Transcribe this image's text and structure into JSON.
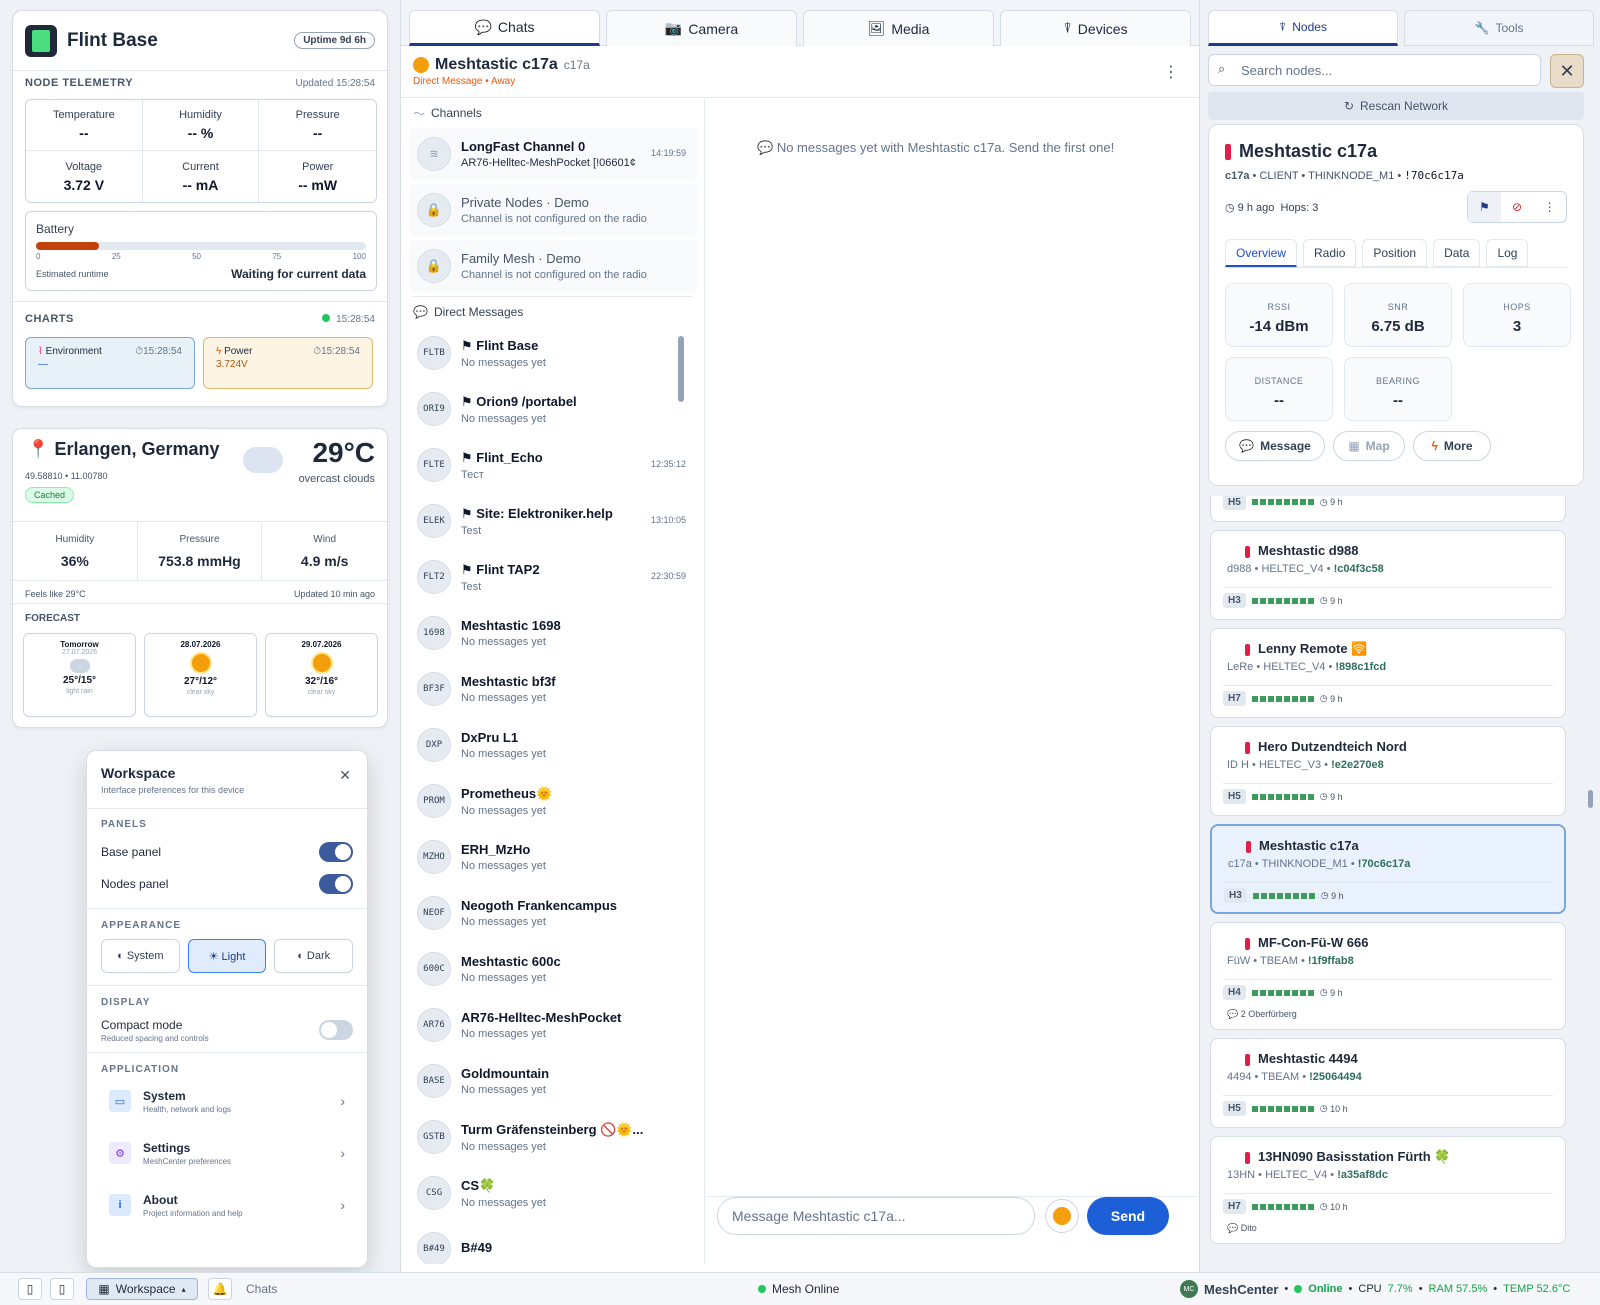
{
  "base": {
    "title": "Flint Base",
    "uptime": "Uptime 9d 6h",
    "telemetry_heading": "NODE TELEMETRY",
    "telemetry_updated": "Updated 15:28:54",
    "telemetry": [
      {
        "label": "Temperature",
        "value": "--"
      },
      {
        "label": "Humidity",
        "value": "-- %"
      },
      {
        "label": "Pressure",
        "value": "--"
      },
      {
        "label": "Voltage",
        "value": "3.72 V"
      },
      {
        "label": "Current",
        "value": "-- mA"
      },
      {
        "label": "Power",
        "value": "-- mW"
      }
    ],
    "battery_label": "Battery",
    "battery_level": 0.19,
    "battery_ticks": [
      "0",
      "25",
      "50",
      "75",
      "100"
    ],
    "runtime_label": "Estimated runtime",
    "runtime_value": "Waiting for current data",
    "charts_heading": "CHARTS",
    "charts_time": "15:28:54",
    "env_tile": {
      "label": "Environment",
      "time": "15:28:54",
      "value": "—"
    },
    "power_tile": {
      "label": "Power",
      "time": "15:28:54",
      "value": "3.724V"
    }
  },
  "weather": {
    "location": "Erlangen, Germany",
    "coords": "49.58810 • 11.00780",
    "temp": "29°C",
    "condition": "overcast clouds",
    "cached": "Cached",
    "stats": [
      {
        "label": "Humidity",
        "value": "36%"
      },
      {
        "label": "Pressure",
        "value": "753.8 mmHg"
      },
      {
        "label": "Wind",
        "value": "4.9 m/s"
      }
    ],
    "feels": "Feels like 29°C",
    "updated": "Updated 10 min ago",
    "forecast_heading": "FORECAST",
    "forecast": [
      {
        "title": "Tomorrow",
        "date": "27.07.2026",
        "temp": "25°/15°",
        "desc": "light rain"
      },
      {
        "title": "28.07.2026",
        "date": "",
        "temp": "27°/12°",
        "desc": "clear sky"
      },
      {
        "title": "29.07.2026",
        "date": "",
        "temp": "32°/16°",
        "desc": "clear sky"
      }
    ]
  },
  "workspace": {
    "title": "Workspace",
    "subtitle": "Interface preferences for this device",
    "panels_heading": "PANELS",
    "base_panel": "Base panel",
    "nodes_panel": "Nodes panel",
    "appearance_heading": "APPEARANCE",
    "themes": [
      "◐ System",
      "☀ Light",
      "◐ Dark"
    ],
    "display_heading": "DISPLAY",
    "compact": "Compact mode",
    "compact_sub": "Reduced spacing and controls",
    "application_heading": "APPLICATION",
    "apps": [
      {
        "title": "System",
        "sub": "Health, network and logs"
      },
      {
        "title": "Settings",
        "sub": "MeshCenter preferences"
      },
      {
        "title": "About",
        "sub": "Project information and help"
      }
    ]
  },
  "mid": {
    "tabs": [
      "Chats",
      "Camera",
      "Media",
      "Devices"
    ],
    "chat_name": "Meshtastic c17a",
    "chat_short": "c17a",
    "chat_status": "Direct Message • Away",
    "channels_heading": "Channels",
    "channels": [
      {
        "title": "LongFast Channel 0",
        "sub": "AR76-Helltec-MeshPocket [!06601¢",
        "time": "14:19:59",
        "icon": "≋"
      },
      {
        "title": "Private Nodes · Demo",
        "sub": "Channel is not configured on the radio",
        "time": "",
        "icon": "🔒"
      },
      {
        "title": "Family Mesh · Demo",
        "sub": "Channel is not configured on the radio",
        "time": "",
        "icon": "🔒"
      }
    ],
    "dm_heading": "Direct Messages",
    "dms": [
      {
        "av": "FLTB",
        "title": "⚑ Flint Base",
        "sub": "No messages yet",
        "time": ""
      },
      {
        "av": "ORI9",
        "title": "⚑ Orion9 /portabel",
        "sub": "No messages yet",
        "time": ""
      },
      {
        "av": "FLTE",
        "title": "⚑ Flint_Echo",
        "sub": "Тест",
        "time": "12:35:12"
      },
      {
        "av": "ELEK",
        "title": "⚑ Site: Elektroniker.help",
        "sub": "Test",
        "time": "13:10:05"
      },
      {
        "av": "FLT2",
        "title": "⚑ Flint TAP2",
        "sub": "Test",
        "time": "22:30:59"
      },
      {
        "av": "1698",
        "title": "Meshtastic 1698",
        "sub": "No messages yet",
        "time": ""
      },
      {
        "av": "BF3F",
        "title": "Meshtastic bf3f",
        "sub": "No messages yet",
        "time": ""
      },
      {
        "av": "DXP",
        "title": "DxPru L1",
        "sub": "No messages yet",
        "time": ""
      },
      {
        "av": "PROM",
        "title": "Prometheus🌞",
        "sub": "No messages yet",
        "time": ""
      },
      {
        "av": "MZHO",
        "title": "ERH_MzHo",
        "sub": "No messages yet",
        "time": ""
      },
      {
        "av": "NEOF",
        "title": "Neogoth Frankencampus",
        "sub": "No messages yet",
        "time": ""
      },
      {
        "av": "600C",
        "title": "Meshtastic 600c",
        "sub": "No messages yet",
        "time": ""
      },
      {
        "av": "AR76",
        "title": "AR76-Helltec-MeshPocket",
        "sub": "No messages yet",
        "time": ""
      },
      {
        "av": "BASE",
        "title": "Goldmountain",
        "sub": "No messages yet",
        "time": ""
      },
      {
        "av": "GSTB",
        "title": "Turm Gräfensteinberg 🚫🌞...",
        "sub": "No messages yet",
        "time": ""
      },
      {
        "av": "CSG",
        "title": "CS🍀",
        "sub": "No messages yet",
        "time": ""
      },
      {
        "av": "B#49",
        "title": "B#49",
        "sub": "",
        "time": ""
      }
    ],
    "empty_message": "No messages yet with Meshtastic c17a. Send the first one!",
    "input_placeholder": "Message Meshtastic c17a...",
    "send": "Send"
  },
  "right": {
    "tabs": [
      "Nodes",
      "Tools"
    ],
    "search_placeholder": "Search nodes...",
    "rescan": "Rescan Network",
    "detail": {
      "name": "Meshtastic c17a",
      "short": "c17a",
      "role": "CLIENT",
      "hw": "THINKNODE_M1",
      "id": "!70c6c17a",
      "seen": "9 h ago",
      "hops": "Hops: 3",
      "tabs": [
        "Overview",
        "Radio",
        "Position",
        "Data",
        "Log"
      ],
      "stats": [
        {
          "label": "RSSI",
          "value": "-14 dBm"
        },
        {
          "label": "SNR",
          "value": "6.75 dB"
        },
        {
          "label": "HOPS",
          "value": "3"
        },
        {
          "label": "DISTANCE",
          "value": "--"
        },
        {
          "label": "BEARING",
          "value": "--"
        }
      ],
      "buttons": [
        "Message",
        "Map",
        "More"
      ]
    },
    "nodes": [
      {
        "name": "",
        "short": "",
        "hw": "",
        "id": "",
        "hop": "H5",
        "age": "9 h",
        "extra": ""
      },
      {
        "name": "Meshtastic d988",
        "short": "d988",
        "hw": "HELTEC_V4",
        "id": "!c04f3c58",
        "hop": "H3",
        "age": "9 h",
        "extra": ""
      },
      {
        "name": "Lenny Remote 🛜",
        "short": "LeRe",
        "hw": "HELTEC_V4",
        "id": "!898c1fcd",
        "hop": "H7",
        "age": "9 h",
        "extra": ""
      },
      {
        "name": "Hero Dutzendteich Nord",
        "short": "ID H",
        "hw": "HELTEC_V3",
        "id": "!e2e270e8",
        "hop": "H5",
        "age": "9 h",
        "extra": ""
      },
      {
        "name": "Meshtastic c17a",
        "short": "c17a",
        "hw": "THINKNODE_M1",
        "id": "!70c6c17a",
        "hop": "H3",
        "age": "9 h",
        "extra": ""
      },
      {
        "name": "MF-Con-Fü-W 666",
        "short": "FüW",
        "hw": "TBEAM",
        "id": "!1f9ffab8",
        "hop": "H4",
        "age": "9 h",
        "extra": "2 Oberfürberg"
      },
      {
        "name": "Meshtastic 4494",
        "short": "4494",
        "hw": "TBEAM",
        "id": "!25064494",
        "hop": "H5",
        "age": "10 h",
        "extra": ""
      },
      {
        "name": "13HN090 Basisstation Fürth 🍀",
        "short": "13HN",
        "hw": "HELTEC_V4",
        "id": "!a35af8dc",
        "hop": "H7",
        "age": "10 h",
        "extra": "Dito"
      }
    ]
  },
  "bottom": {
    "workspace": "Workspace",
    "chats": "Chats",
    "mesh": "Mesh Online",
    "brand": "MeshCenter",
    "online": "Online",
    "cpu_label": "CPU",
    "cpu": "7.7%",
    "ram": "RAM 57.5%",
    "temp": "TEMP 52.6°C"
  },
  "colors": {
    "accent": "#1d5fd6",
    "danger": "#e11d48",
    "ok": "#22c55e",
    "battery": "#c2410c"
  }
}
